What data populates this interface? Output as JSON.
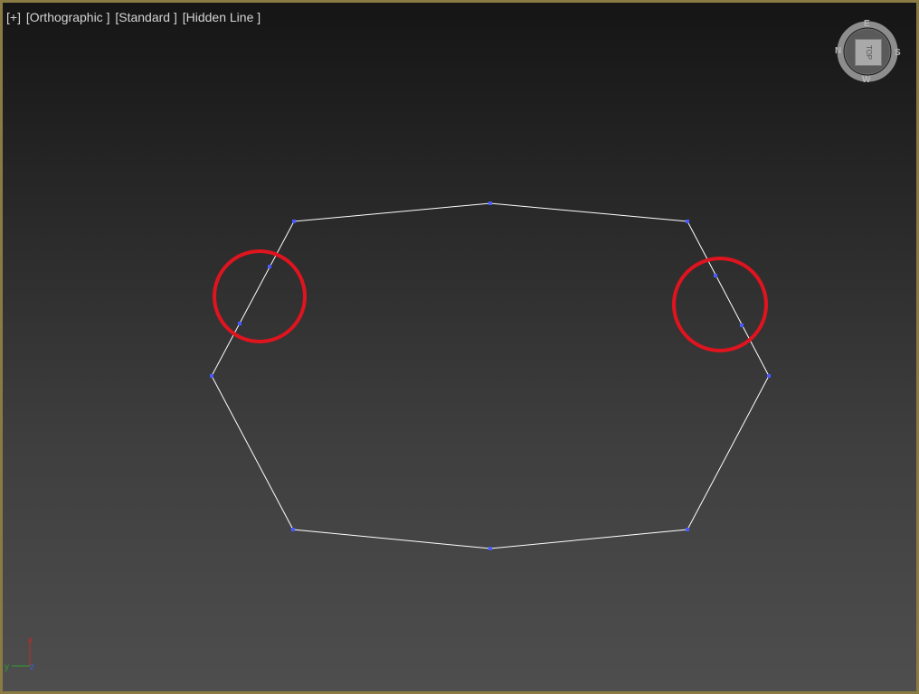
{
  "viewport": {
    "label_parts": [
      "[+]",
      "[Orthographic ]",
      "[Standard ]",
      "[Hidden Line ]"
    ]
  },
  "viewcube": {
    "face_label": "TOP",
    "compass": {
      "north": "N",
      "east": "E",
      "south": "S",
      "west": "W"
    }
  },
  "axis_gizmo": {
    "x": "x",
    "y": "y",
    "z": "z"
  },
  "colors": {
    "frame": "#8a7a44",
    "spline": "#ffffff",
    "vertex": "#4a5aff",
    "highlight_circle": "#e0141e",
    "axis_x": "#c62828",
    "axis_y": "#2e9e2e",
    "axis_z": "#3b5bdb"
  },
  "icons": [
    "viewcube-icon",
    "axis-gizmo-icon"
  ]
}
